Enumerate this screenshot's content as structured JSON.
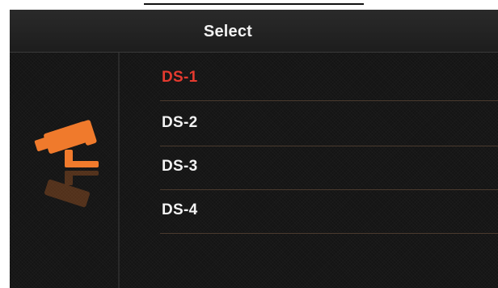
{
  "header": {
    "title": "Select"
  },
  "menu": {
    "items": [
      {
        "label": "DS-1",
        "selected": true
      },
      {
        "label": "DS-2",
        "selected": false
      },
      {
        "label": "DS-3",
        "selected": false
      },
      {
        "label": "DS-4",
        "selected": false
      }
    ]
  },
  "sidebar": {
    "icon": "security-camera-icon"
  },
  "colors": {
    "selected_text": "#e53a2f",
    "text": "#f2f2f2",
    "icon": "#f07a2c",
    "background": "#141414"
  }
}
